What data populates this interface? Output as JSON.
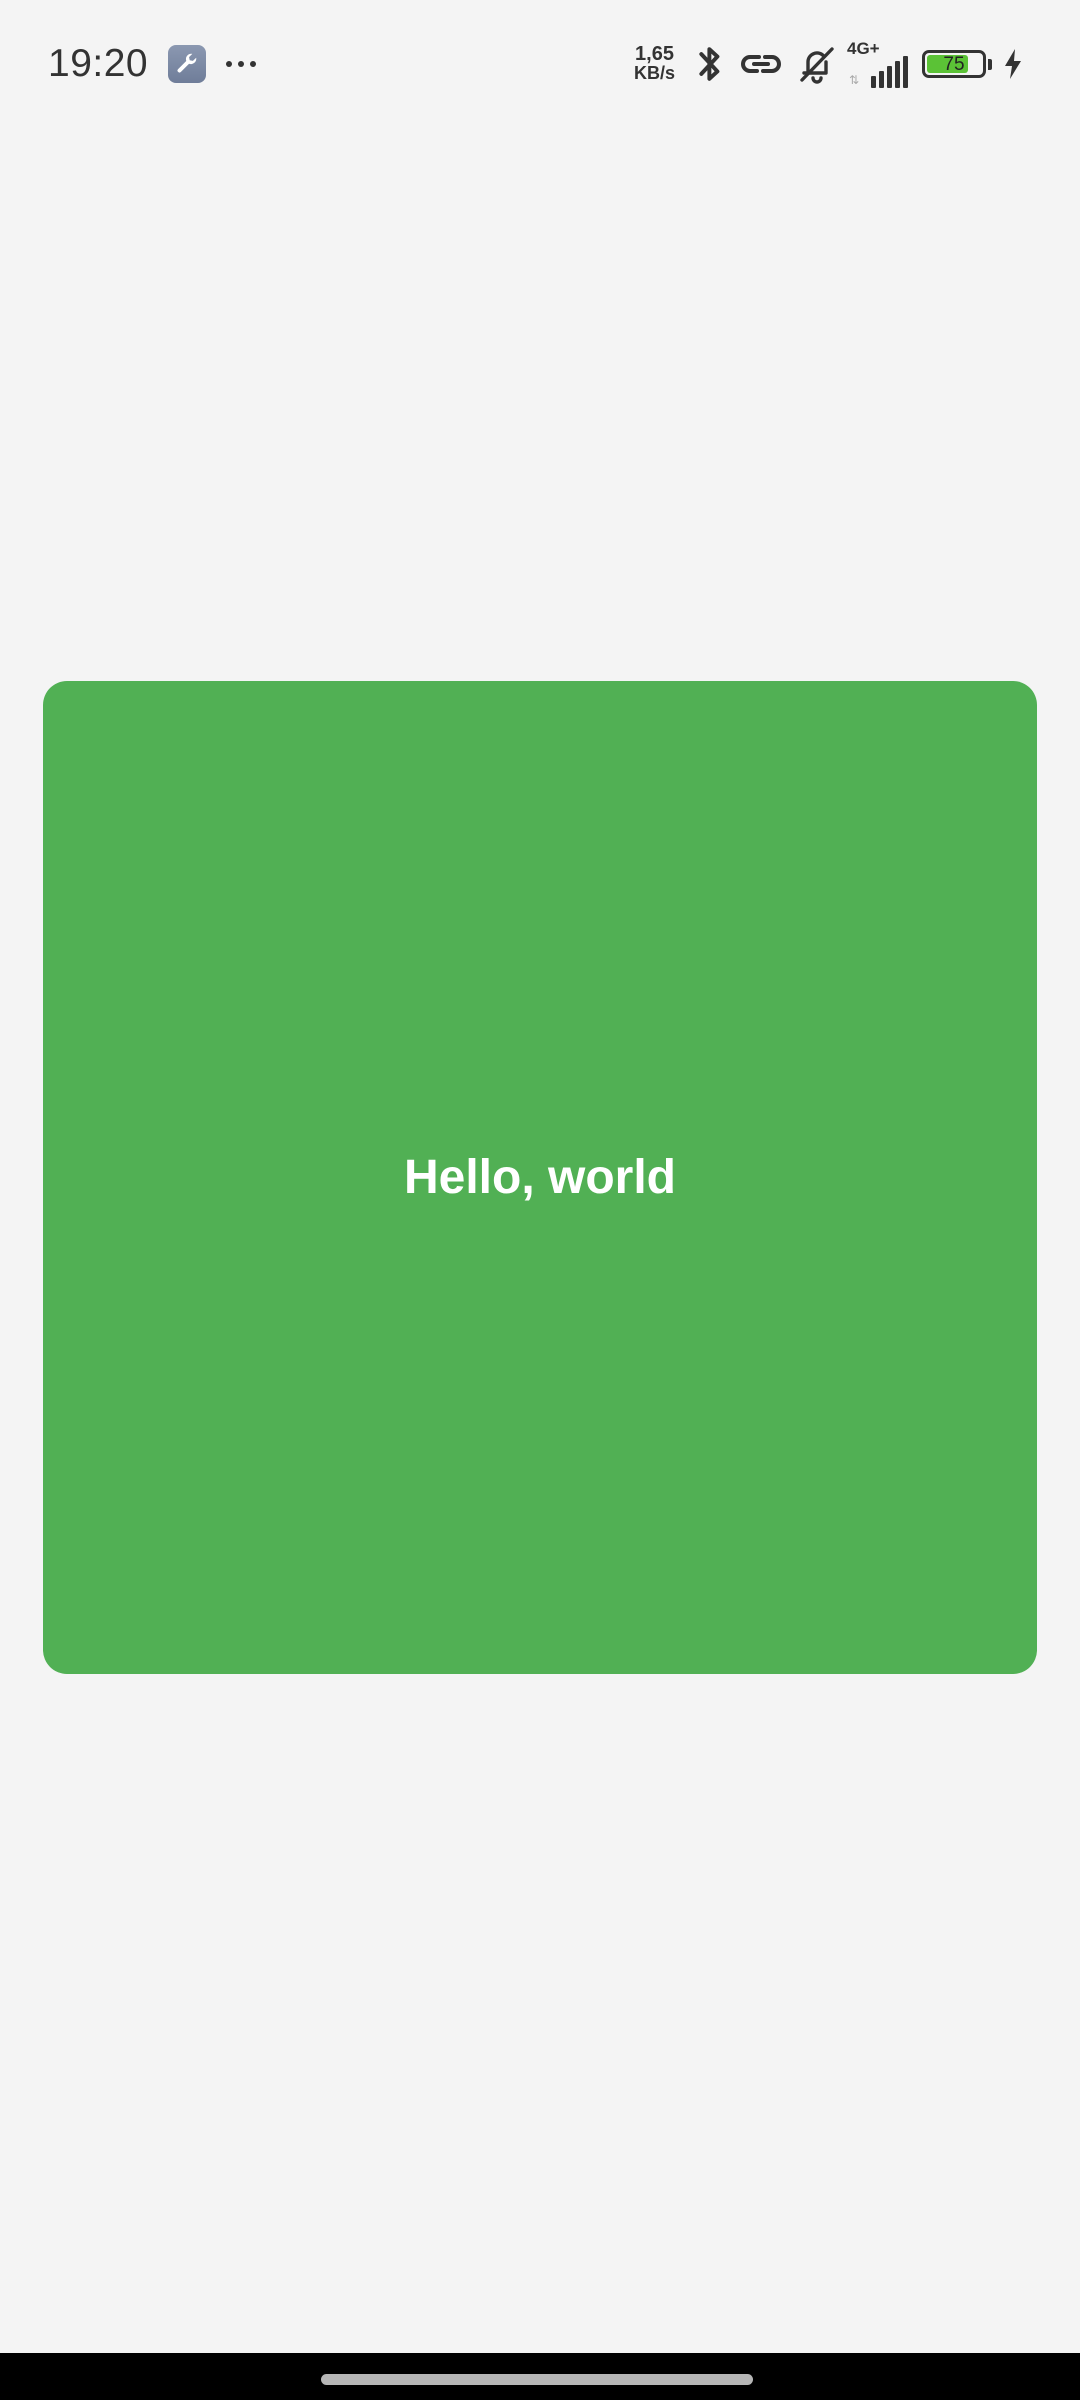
{
  "status_bar": {
    "time": "19:20",
    "notification_icons": [
      "wrench-icon",
      "more-dots-icon"
    ],
    "network_speed": {
      "value": "1,65",
      "unit": "KB/s"
    },
    "icons": [
      "bluetooth-icon",
      "link-icon",
      "bell-off-icon"
    ],
    "signal": {
      "technology": "4G+",
      "bars": 5
    },
    "battery": {
      "level": "75",
      "fraction": 0.75,
      "charging": true
    }
  },
  "main": {
    "card": {
      "text": "Hello, world",
      "color": "#51b054"
    }
  },
  "colors": {
    "background": "#f4f4f4",
    "card": "#51b054",
    "battery_fill": "#5bc236",
    "nav_bar": "#000000"
  }
}
